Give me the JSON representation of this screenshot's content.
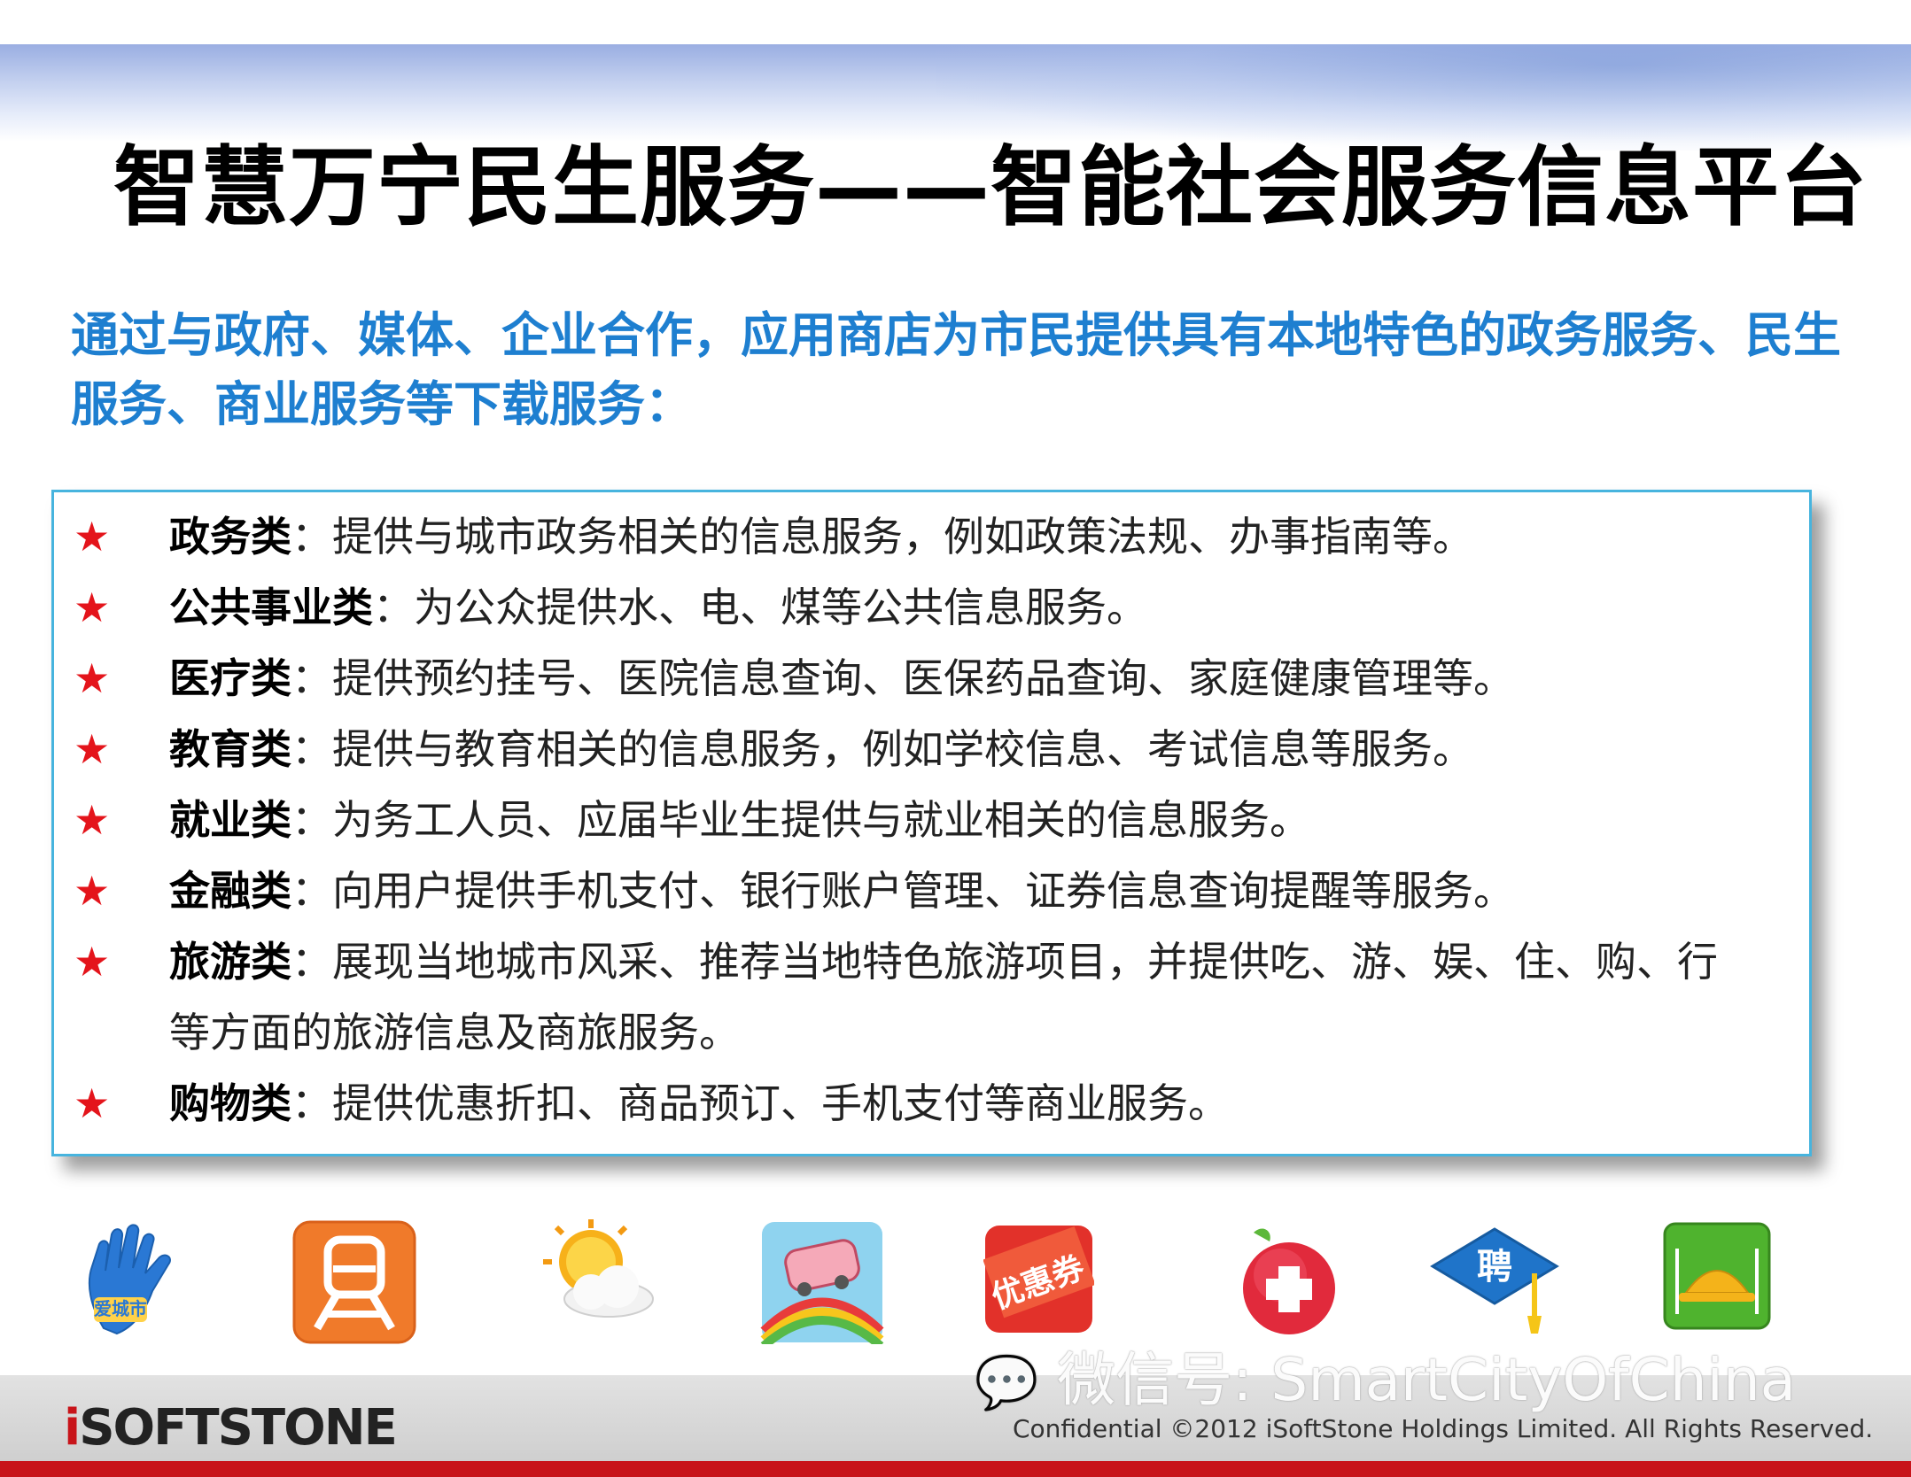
{
  "title": "智慧万宁民生服务——智能社会服务信息平台",
  "intro": "通过与政府、媒体、企业合作，应用商店为市民提供具有本地特色的政务服务、民生服务、商业服务等下载服务：",
  "star_symbol": "★",
  "items": [
    {
      "label": "政务类",
      "text": "：提供与城市政务相关的信息服务，例如政策法规、办事指南等。"
    },
    {
      "label": "公共事业类",
      "text": "：为公众提供水、电、煤等公共信息服务。"
    },
    {
      "label": "医疗类",
      "text": "：提供预约挂号、医院信息查询、医保药品查询、家庭健康管理等。"
    },
    {
      "label": "教育类",
      "text": "：提供与教育相关的信息服务，例如学校信息、考试信息等服务。"
    },
    {
      "label": "就业类",
      "text": "：为务工人员、应届毕业生提供与就业相关的信息服务。"
    },
    {
      "label": "金融类",
      "text": "：向用户提供手机支付、银行账户管理、证券信息查询提醒等服务。"
    },
    {
      "label": "旅游类",
      "text": "：展现当地城市风采、推荐当地特色旅游项目，并提供吃、游、娱、住、购、行",
      "continuation": "等方面的旅游信息及商旅服务。"
    },
    {
      "label": "购物类",
      "text": "：提供优惠折扣、商品预订、手机支付等商业服务。"
    }
  ],
  "app_icons": [
    {
      "name": "hand-city-app-icon",
      "label": "爱城市"
    },
    {
      "name": "train-app-icon"
    },
    {
      "name": "weather-app-icon"
    },
    {
      "name": "travel-bus-app-icon"
    },
    {
      "name": "discount-app-icon",
      "label": "优惠券"
    },
    {
      "name": "health-cross-app-icon"
    },
    {
      "name": "jobs-app-icon",
      "label": "聘"
    },
    {
      "name": "food-service-app-icon"
    }
  ],
  "footer": {
    "logo_prefix": "i",
    "logo_text": "SOFTSTONE",
    "watermark": "微信号: SmartCityOfChina",
    "copyright": "Confidential ©2012 iSoftStone Holdings Limited. All Rights Reserved."
  },
  "colors": {
    "accent_blue": "#1e7fd0",
    "star_red": "#e4141b",
    "box_border": "#47b4de",
    "footer_red": "#c8141a"
  }
}
